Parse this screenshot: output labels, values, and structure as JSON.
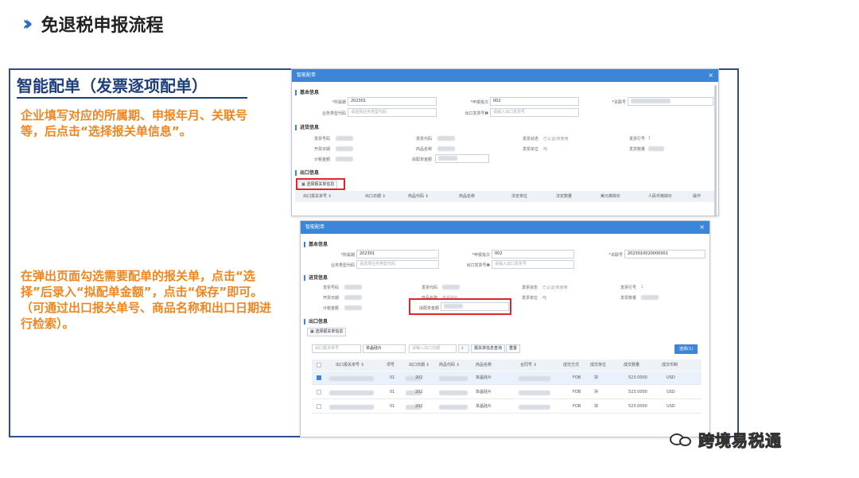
{
  "page": {
    "title": "免退税申报流程"
  },
  "left": {
    "heading": "智能配单（发票逐项配单）",
    "step1": "企业填写对应的所属期、申报年月、关联号等，后点击“选择报关单信息”。",
    "step2": "在弹出页面勾选需要配单的报关单，点击“选择”后录入“拟配单金额”，点击“保存”即可。（可通过出口报关单号、商品名称和出口日期进行检索）。"
  },
  "win1": {
    "title": "智能配单",
    "close": "×",
    "basic_section": "基本信息",
    "period_label": "*所属期",
    "period_value": "202301",
    "batch_label": "*申报批次",
    "batch_value": "002",
    "relno_label": "*关联号",
    "biz_type_label": "业务类型代码",
    "biz_type_placeholder": "请选择业务类型代码",
    "export_invoice_label": "出口发票号❶",
    "export_invoice_placeholder": "请输入出口发票号",
    "purchase_section": "进货信息",
    "inv_code_label": "发票号码",
    "inv_no_label": "发票代码",
    "inv_status_label": "发票状态",
    "inv_status_value": "已认证/未使用",
    "inv_row_label": "发票行号",
    "inv_row_value": "1",
    "issue_date_label": "开票日期",
    "goods_name_label": "商品名称",
    "inv_unit_label": "发票单位",
    "inv_unit_value": "吨",
    "inv_qty_label": "发票数量",
    "tax_amount_label": "计税金额",
    "planned_amount_label": "拟配单金额",
    "export_section": "出口信息",
    "select_customs_button": "选择报关单信息",
    "table_headers": [
      "出口报关单号 ⇕",
      "出口日期 ⇕",
      "商品代码 ⇕",
      "商品名称",
      "法定单位",
      "法定数量",
      "美元离岸价",
      "人民币离岸价",
      "操作"
    ]
  },
  "win2": {
    "title": "智能配单",
    "close": "×",
    "basic_section": "基本信息",
    "period_label": "*所属期",
    "period_value": "202301",
    "batch_label": "*申报批次",
    "batch_value": "002",
    "relno_label": "*关联号",
    "relno_value": "2023010020000001",
    "biz_type_label": "业务类型代码",
    "biz_type_placeholder": "请选择业务类型代码",
    "export_invoice_label": "出口发票号❶",
    "export_invoice_placeholder": "请输入出口发票号",
    "purchase_section": "进货信息",
    "inv_code_label": "发票号码",
    "inv_no_label": "发票代码",
    "inv_status_label": "发票状态",
    "inv_status_value": "已认证/未使用",
    "inv_row_label": "发票行号",
    "inv_row_value": "1",
    "issue_date_label": "开票日期",
    "goods_name_label": "商品名称",
    "goods_name_value": "单晶硅片",
    "inv_unit_label": "发票单位",
    "inv_unit_value": "吨",
    "inv_qty_label": "发票数量",
    "tax_amount_label": "计税金额",
    "planned_amount_label": "拟配单金额",
    "export_section": "出口信息",
    "select_customs_button": "选择报关单信息",
    "search_customs_placeholder": "出口报关单号",
    "search_goods_value": "单晶硅片",
    "search_date_placeholder": "请输入出口日期",
    "search_icon": "search-icon",
    "query_customs_button": "报关单信息查询",
    "reset_button": "重置",
    "choose_button": "选择(1)",
    "table_headers": [
      "出口报关单号 ⇕",
      "项号",
      "出口日期 ⇕",
      "商品代码 ⇕",
      "商品名称",
      "合同号 ⇕",
      "成交方式",
      "成交单位",
      "成交数量",
      "成交币制"
    ],
    "rows": [
      {
        "item": "01",
        "date": "202",
        "name": "单晶硅片",
        "method": "FOB",
        "unit": "块",
        "qty": "523.0000",
        "currency": "USD",
        "checked": true
      },
      {
        "item": "01",
        "date": "202",
        "name": "单晶硅片",
        "method": "FOB",
        "unit": "块",
        "qty": "523.0000",
        "currency": "USD",
        "checked": false
      },
      {
        "item": "01",
        "date": "202",
        "name": "单晶硅片",
        "method": "FOB",
        "unit": "块",
        "qty": "523.0000",
        "currency": "USD",
        "checked": false
      }
    ]
  },
  "watermark": {
    "logo_icon": "wechat-icon",
    "text": "跨境易税通"
  }
}
